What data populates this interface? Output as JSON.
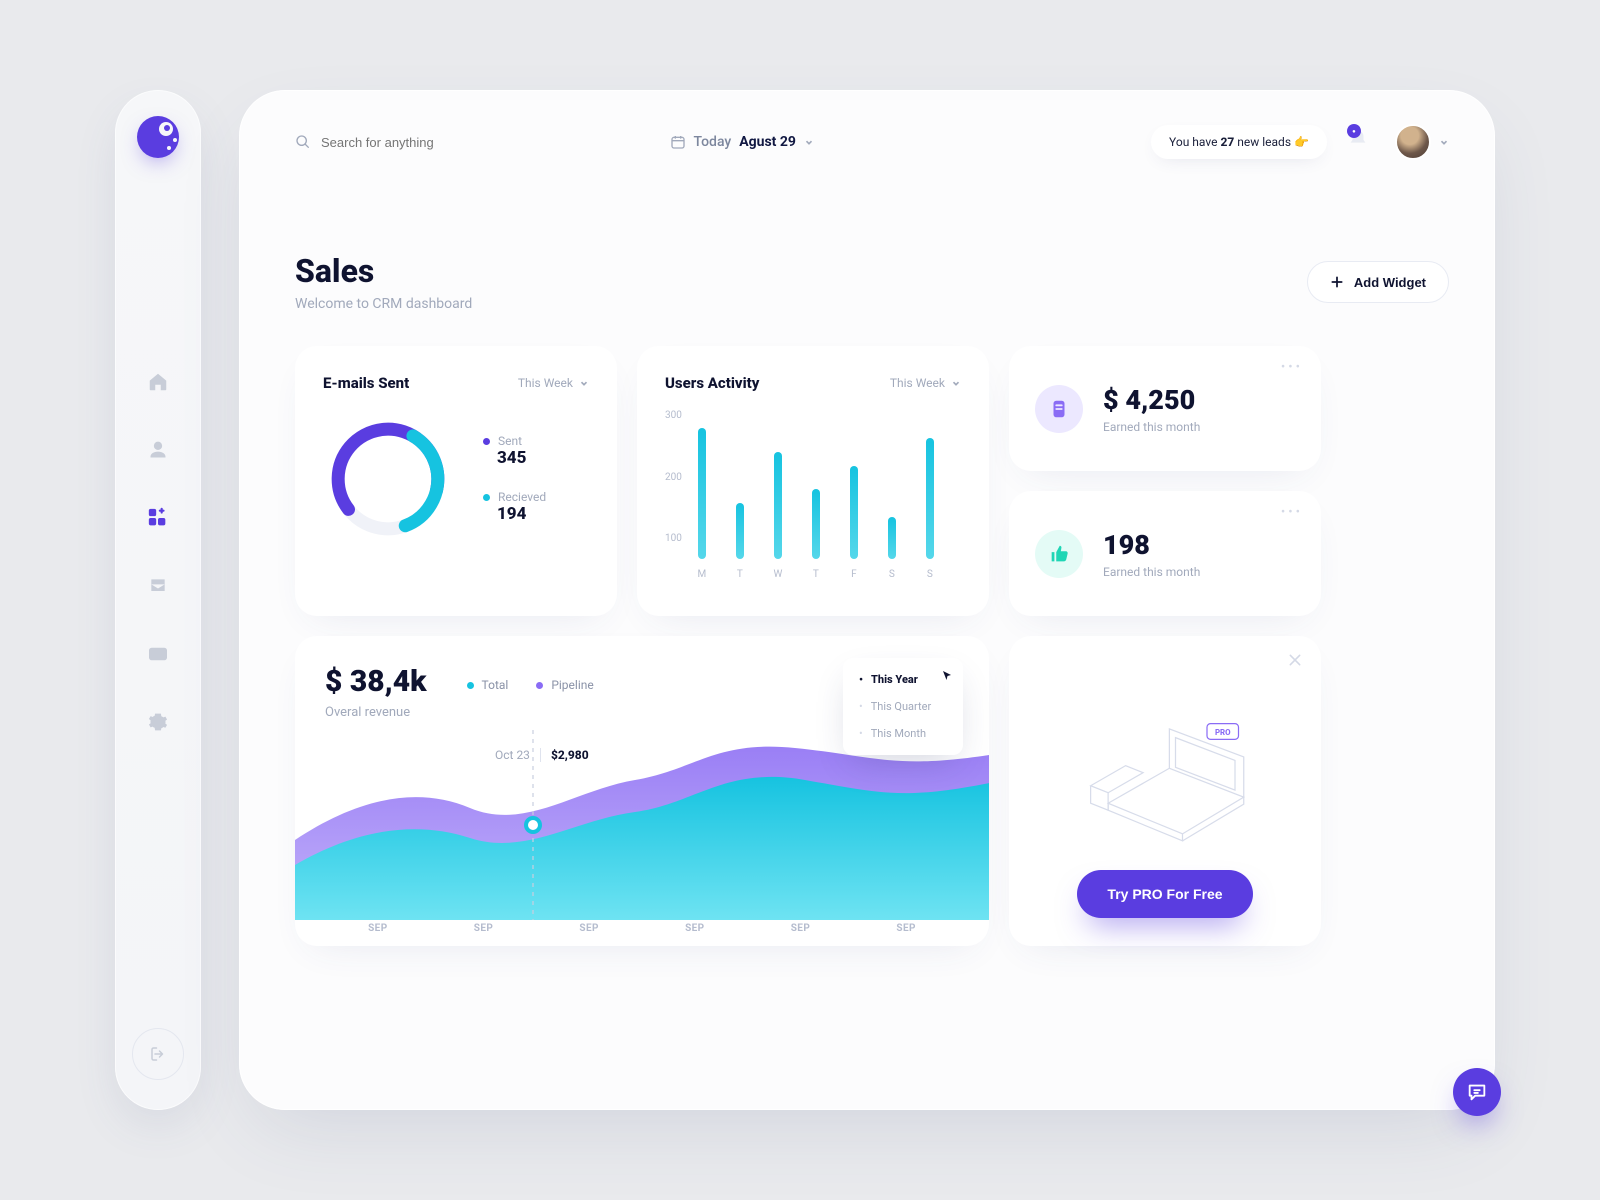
{
  "sidebar": {
    "nav": [
      {
        "name": "home-icon"
      },
      {
        "name": "user-icon"
      },
      {
        "name": "apps-icon",
        "active": true
      },
      {
        "name": "inbox-icon"
      },
      {
        "name": "wallet-icon"
      },
      {
        "name": "settings-icon"
      }
    ]
  },
  "topbar": {
    "search_placeholder": "Search for anything",
    "date_prefix": "Today",
    "date_value": "Agust 29",
    "leads_pre": "You have",
    "leads_count": "27",
    "leads_post": "new leads",
    "leads_emoji": "👉",
    "notification_count": "●"
  },
  "heading": {
    "title": "Sales",
    "subtitle": "Welcome to CRM dashboard",
    "add_widget": "Add Widget"
  },
  "emails": {
    "title": "E-mails Sent",
    "period": "This Week",
    "sent_label": "Sent",
    "sent_value": "345",
    "received_label": "Recieved",
    "received_value": "194"
  },
  "activity": {
    "title": "Users Activity",
    "period": "This Week"
  },
  "stats": {
    "earned_value": "$ 4,250",
    "earned_sub": "Earned this month",
    "likes_value": "198",
    "likes_sub": "Earned this month"
  },
  "revenue": {
    "value": "$ 38,4k",
    "subtitle": "Overal revenue",
    "legend_total": "Total",
    "legend_pipeline": "Pipeline",
    "menu": {
      "y": "This Year",
      "q": "This Quarter",
      "m": "This Month"
    },
    "tooltip_date": "Oct 23",
    "tooltip_value": "$2,980",
    "xaxis": [
      "SEP",
      "SEP",
      "SEP",
      "SEP",
      "SEP",
      "SEP"
    ]
  },
  "pro": {
    "badge": "PRO",
    "cta": "Try PRO For Free"
  },
  "colors": {
    "primary": "#5a3de0",
    "cyan": "#16c3e0",
    "purple": "#8a6cf5"
  },
  "chart_data": [
    {
      "type": "pie",
      "title": "E-mails Sent",
      "series": [
        {
          "name": "Sent",
          "value": 345,
          "color": "#5a3de0"
        },
        {
          "name": "Recieved",
          "value": 194,
          "color": "#16c3e0"
        }
      ]
    },
    {
      "type": "bar",
      "title": "Users Activity",
      "ylabel": "",
      "ylim": [
        0,
        300
      ],
      "yticks": [
        100,
        200,
        300
      ],
      "categories": [
        "M",
        "T",
        "W",
        "T",
        "F",
        "S",
        "S"
      ],
      "values": [
        280,
        120,
        230,
        150,
        200,
        90,
        260
      ]
    },
    {
      "type": "area",
      "title": "Overal revenue",
      "x": [
        "SEP",
        "SEP",
        "SEP",
        "SEP",
        "SEP",
        "SEP"
      ],
      "series": [
        {
          "name": "Pipeline",
          "color": "#8a6cf5",
          "values": [
            35,
            55,
            40,
            60,
            85,
            70
          ]
        },
        {
          "name": "Total",
          "color": "#16c3e0",
          "values": [
            25,
            40,
            28,
            50,
            70,
            58
          ]
        }
      ],
      "tooltip": {
        "x": "Oct 23",
        "value": "$2,980",
        "point_index": 2
      }
    }
  ]
}
